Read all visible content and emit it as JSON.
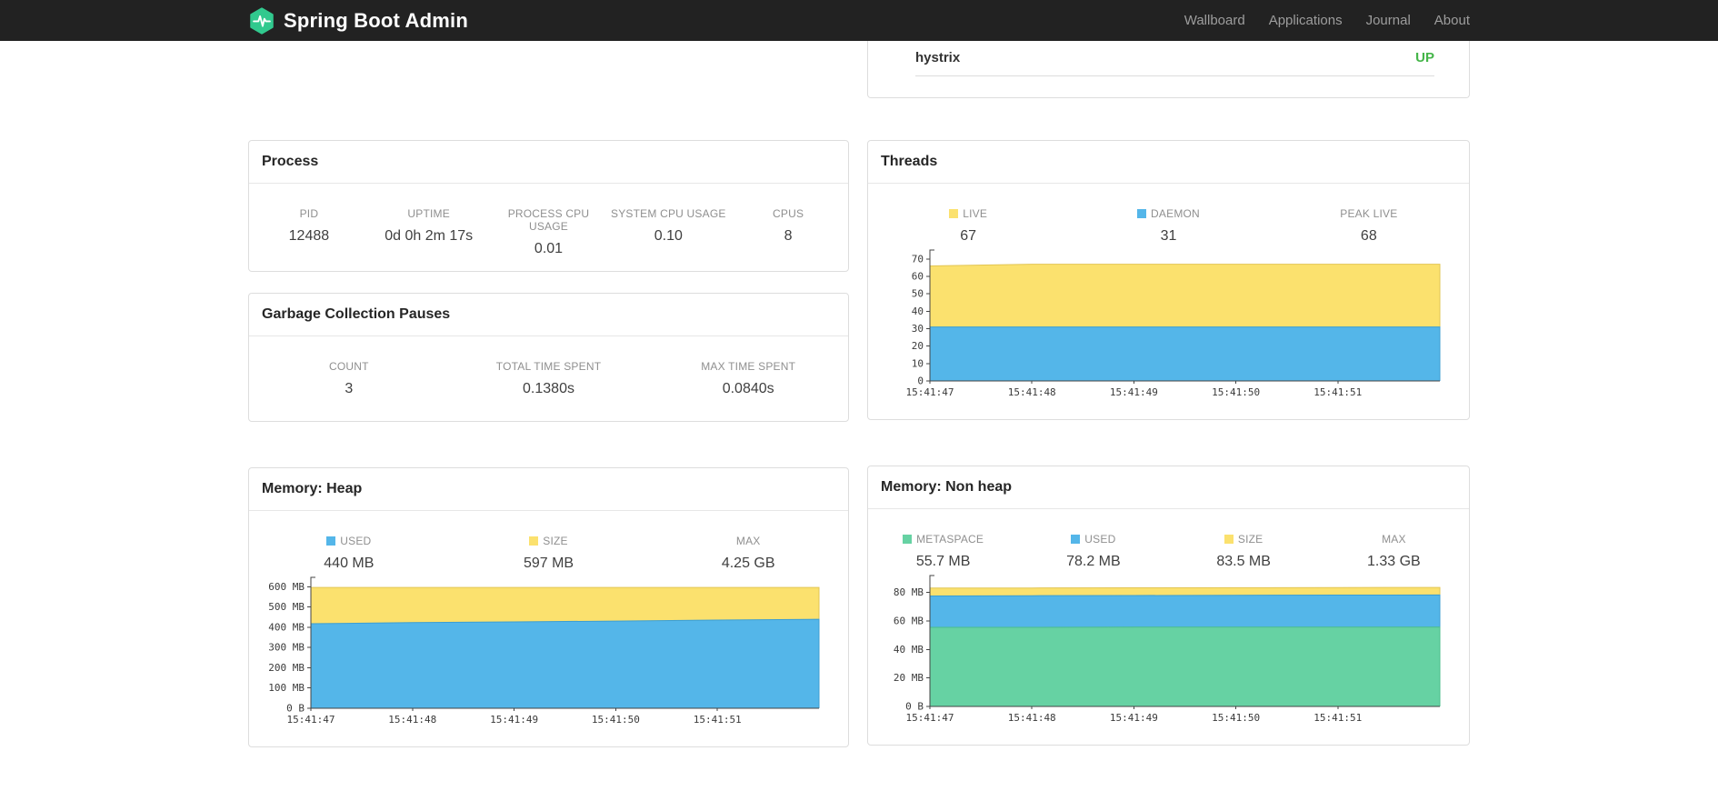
{
  "navbar": {
    "brand": "Spring Boot Admin",
    "items": [
      {
        "label": "Wallboard"
      },
      {
        "label": "Applications"
      },
      {
        "label": "Journal"
      },
      {
        "label": "About"
      }
    ]
  },
  "applications": {
    "rows": [
      {
        "name": "hystrix",
        "status": "UP",
        "status_color": "#44b549"
      }
    ]
  },
  "cards": {
    "process": {
      "title": "Process",
      "stats": [
        {
          "label": "PID",
          "value": "12488"
        },
        {
          "label": "UPTIME",
          "value": "0d 0h 2m 17s"
        },
        {
          "label": "PROCESS CPU USAGE",
          "value": "0.01"
        },
        {
          "label": "SYSTEM CPU USAGE",
          "value": "0.10"
        },
        {
          "label": "CPUS",
          "value": "8"
        }
      ]
    },
    "gc": {
      "title": "Garbage Collection Pauses",
      "stats": [
        {
          "label": "COUNT",
          "value": "3"
        },
        {
          "label": "TOTAL TIME SPENT",
          "value": "0.1380s"
        },
        {
          "label": "MAX TIME SPENT",
          "value": "0.0840s"
        }
      ]
    },
    "threads": {
      "title": "Threads",
      "stats": [
        {
          "label": "LIVE",
          "value": "67",
          "color": "#fbe16e"
        },
        {
          "label": "DAEMON",
          "value": "31",
          "color": "#54b6e9"
        },
        {
          "label": "PEAK LIVE",
          "value": "68",
          "color": null
        }
      ]
    },
    "memory_heap": {
      "title": "Memory: Heap",
      "stats": [
        {
          "label": "USED",
          "value": "440 MB",
          "color": "#54b6e9"
        },
        {
          "label": "SIZE",
          "value": "597 MB",
          "color": "#fbe16e"
        },
        {
          "label": "MAX",
          "value": "4.25 GB",
          "color": null
        }
      ]
    },
    "memory_nonheap": {
      "title": "Memory: Non heap",
      "stats": [
        {
          "label": "METASPACE",
          "value": "55.7 MB",
          "color": "#66d2a3"
        },
        {
          "label": "USED",
          "value": "78.2 MB",
          "color": "#54b6e9"
        },
        {
          "label": "SIZE",
          "value": "83.5 MB",
          "color": "#fbe16e"
        },
        {
          "label": "MAX",
          "value": "1.33 GB",
          "color": null
        }
      ]
    }
  },
  "chart_data": [
    {
      "id": "threads",
      "type": "area",
      "title": "Threads",
      "x_labels": [
        "15:41:47",
        "15:41:48",
        "15:41:49",
        "15:41:50",
        "15:41:51"
      ],
      "y_max": 72,
      "y_ticks": [
        {
          "v": 0,
          "label": "0"
        },
        {
          "v": 10,
          "label": "10"
        },
        {
          "v": 20,
          "label": "20"
        },
        {
          "v": 30,
          "label": "30"
        },
        {
          "v": 40,
          "label": "40"
        },
        {
          "v": 50,
          "label": "50"
        },
        {
          "v": 60,
          "label": "60"
        },
        {
          "v": 70,
          "label": "70"
        }
      ],
      "series": [
        {
          "name": "LIVE",
          "color": "#fbe16e",
          "stroke": "#e2c553",
          "values": [
            66,
            67,
            67,
            67,
            67,
            67
          ]
        },
        {
          "name": "DAEMON",
          "color": "#54b6e9",
          "stroke": "#3c9ed2",
          "values": [
            31,
            31,
            31,
            31,
            31,
            31
          ]
        }
      ]
    },
    {
      "id": "memory-heap",
      "type": "area",
      "title": "Memory: Heap",
      "x_labels": [
        "15:41:47",
        "15:41:48",
        "15:41:49",
        "15:41:50",
        "15:41:51"
      ],
      "y_max": 620,
      "y_ticks": [
        {
          "v": 0,
          "label": "0 B"
        },
        {
          "v": 100,
          "label": "100 MB"
        },
        {
          "v": 200,
          "label": "200 MB"
        },
        {
          "v": 300,
          "label": "300 MB"
        },
        {
          "v": 400,
          "label": "400 MB"
        },
        {
          "v": 500,
          "label": "500 MB"
        },
        {
          "v": 600,
          "label": "600 MB"
        }
      ],
      "series": [
        {
          "name": "SIZE",
          "color": "#fbe16e",
          "stroke": "#e2c553",
          "values": [
            597,
            597,
            597,
            597,
            597,
            597
          ]
        },
        {
          "name": "USED",
          "color": "#54b6e9",
          "stroke": "#3c9ed2",
          "values": [
            418,
            423,
            427,
            431,
            436,
            440
          ]
        }
      ]
    },
    {
      "id": "memory-nonheap",
      "type": "area",
      "title": "Memory: Non heap",
      "x_labels": [
        "15:41:47",
        "15:41:48",
        "15:41:49",
        "15:41:50",
        "15:41:51"
      ],
      "y_max": 88,
      "y_ticks": [
        {
          "v": 0,
          "label": "0 B"
        },
        {
          "v": 20,
          "label": "20 MB"
        },
        {
          "v": 40,
          "label": "40 MB"
        },
        {
          "v": 60,
          "label": "60 MB"
        },
        {
          "v": 80,
          "label": "80 MB"
        }
      ],
      "series": [
        {
          "name": "SIZE",
          "color": "#fbe16e",
          "stroke": "#e2c553",
          "values": [
            83.0,
            83.1,
            83.2,
            83.3,
            83.4,
            83.5
          ]
        },
        {
          "name": "USED",
          "color": "#54b6e9",
          "stroke": "#3c9ed2",
          "values": [
            77.5,
            77.7,
            77.8,
            78.0,
            78.1,
            78.2
          ]
        },
        {
          "name": "METASPACE",
          "color": "#66d2a3",
          "stroke": "#4bbd8b",
          "values": [
            55.5,
            55.5,
            55.6,
            55.6,
            55.7,
            55.7
          ]
        }
      ]
    }
  ]
}
